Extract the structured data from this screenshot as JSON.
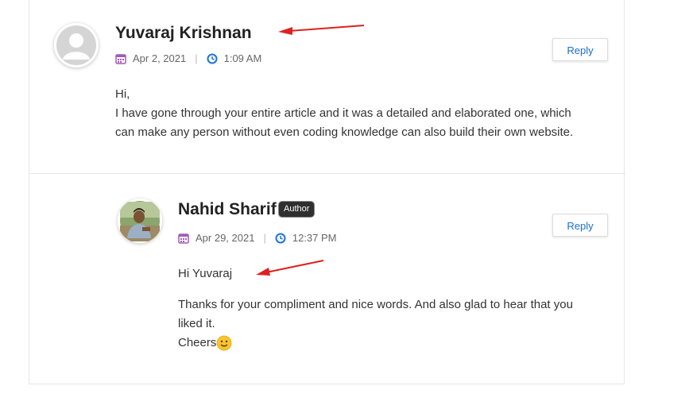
{
  "comments": [
    {
      "author": "Yuvaraj Krishnan",
      "date": "Apr 2, 2021",
      "time": "1:09 AM",
      "reply_label": "Reply",
      "lines": [
        "Hi,",
        "I have gone through your entire article and it was a detailed and elaborated one, which",
        "can make any person without even coding knowledge can also build their own website."
      ]
    },
    {
      "author": "Nahid Sharif",
      "badge": "Author",
      "date": "Apr 29, 2021",
      "time": "12:37 PM",
      "reply_label": "Reply",
      "greeting": "Hi Yuvaraj",
      "lines": [
        "Thanks for your compliment and nice words. And also glad to hear that you",
        "liked it."
      ],
      "signoff": "Cheers"
    }
  ],
  "icons": {
    "date": "calendar-icon",
    "time": "clock-icon",
    "emoji": "smiley-emoji-icon",
    "annotation": "red-arrow-icon"
  },
  "colors": {
    "calendar": "#a35ab8",
    "clock": "#1e73d8",
    "reply_text": "#1a6fd1",
    "annotation": "#e02020",
    "badge_bg": "#2f2f2f"
  }
}
